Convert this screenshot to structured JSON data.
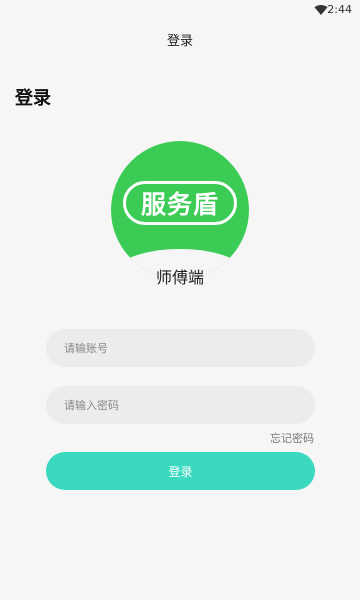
{
  "status_bar": {
    "time": "2:44",
    "wifi_icon": "wifi-icon"
  },
  "header": {
    "title": "登录"
  },
  "page": {
    "heading": "登录"
  },
  "logo": {
    "brand_text": "服务盾",
    "subtitle": "师傅端",
    "brand_color": "#3ccc55"
  },
  "form": {
    "account_placeholder": "请输账号",
    "password_placeholder": "请输入密码",
    "forgot_password": "忘记密码",
    "login_button": "登录",
    "button_color": "#3ad9c0"
  }
}
